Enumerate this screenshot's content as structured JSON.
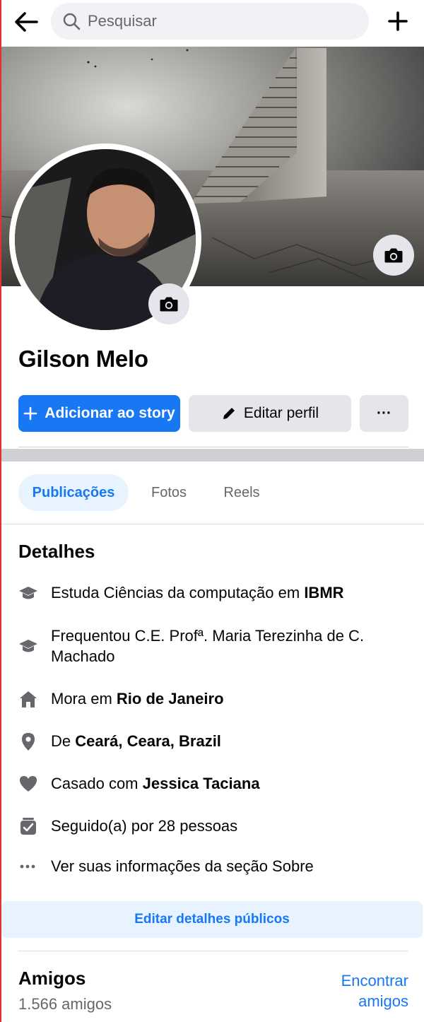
{
  "topbar": {
    "search_placeholder": "Pesquisar"
  },
  "profile": {
    "name": "Gilson Melo"
  },
  "actions": {
    "add_story_label": "Adicionar ao story",
    "edit_profile_label": "Editar perfil",
    "more_label": "···"
  },
  "tabs": [
    {
      "label": "Publicações",
      "active": true
    },
    {
      "label": "Fotos",
      "active": false
    },
    {
      "label": "Reels",
      "active": false
    }
  ],
  "details": {
    "title": "Detalhes",
    "items": [
      {
        "icon": "graduation-cap-icon",
        "prefix": "Estuda Ciências da computação em ",
        "bold": "IBMR"
      },
      {
        "icon": "graduation-cap-icon",
        "prefix": "Frequentou C.E. Profª. Maria Terezinha de C. Machado",
        "bold": ""
      },
      {
        "icon": "home-icon",
        "prefix": "Mora em ",
        "bold": "Rio de Janeiro"
      },
      {
        "icon": "location-pin-icon",
        "prefix": "De ",
        "bold": "Ceará, Ceara, Brazil"
      },
      {
        "icon": "heart-icon",
        "prefix": "Casado com ",
        "bold": "Jessica Taciana"
      },
      {
        "icon": "followers-icon",
        "prefix": "Seguido(a) por 28 pessoas",
        "bold": ""
      },
      {
        "icon": "more-dots-icon",
        "prefix": "Ver suas informações da seção Sobre",
        "bold": ""
      }
    ],
    "edit_public_label": "Editar detalhes públicos"
  },
  "friends": {
    "title": "Amigos",
    "count": "1.566 amigos",
    "find_label": "Encontrar amigos"
  },
  "colors": {
    "accent": "#1877f2",
    "accent_light": "#e7f3ff",
    "button_gray": "#e4e6eb",
    "secondary_text": "#65676b"
  }
}
